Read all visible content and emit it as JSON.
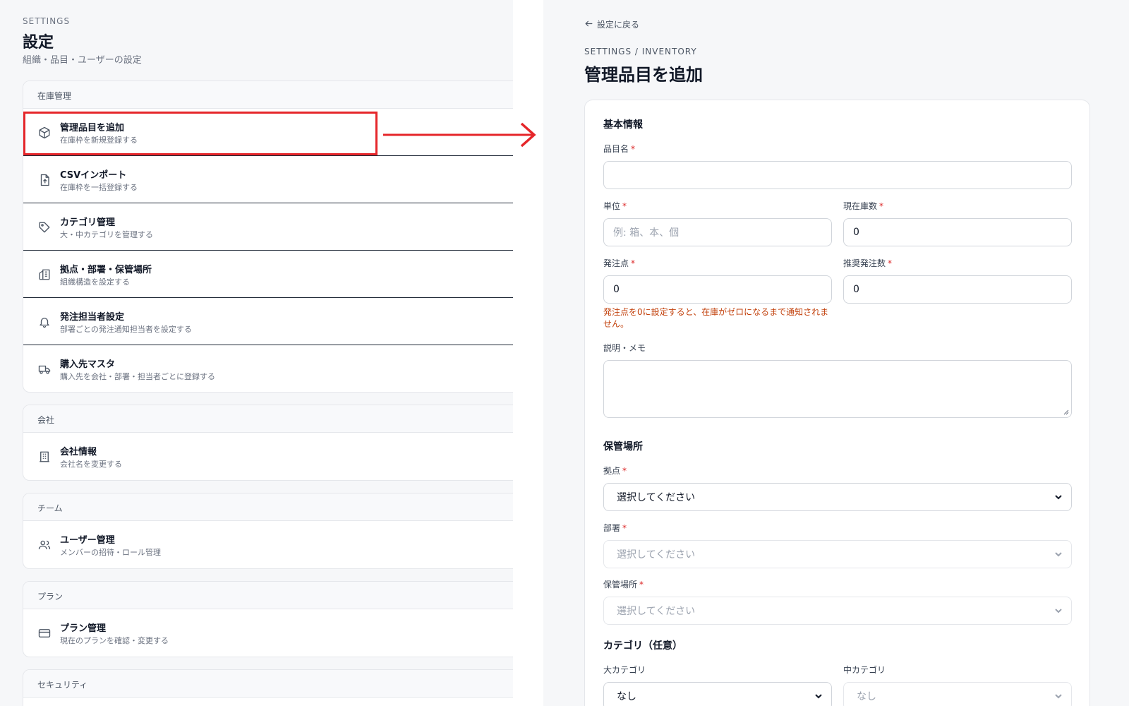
{
  "left": {
    "eyebrow": "SETTINGS",
    "title": "設定",
    "subtitle": "組織・品目・ユーザーの設定",
    "sections": [
      {
        "heading": "在庫管理",
        "items": [
          {
            "title": "管理品目を追加",
            "desc": "在庫枠を新規登録する",
            "icon": "box-icon"
          },
          {
            "title": "CSVインポート",
            "desc": "在庫枠を一括登録する",
            "icon": "file-upload-icon"
          },
          {
            "title": "カテゴリ管理",
            "desc": "大・中カテゴリを管理する",
            "icon": "tag-icon"
          },
          {
            "title": "拠点・部署・保管場所",
            "desc": "組織構造を設定する",
            "icon": "building-icon"
          },
          {
            "title": "発注担当者設定",
            "desc": "部署ごとの発注通知担当者を設定する",
            "icon": "bell-icon"
          },
          {
            "title": "購入先マスタ",
            "desc": "購入先を会社・部署・担当者ごとに登録する",
            "icon": "truck-icon"
          }
        ]
      },
      {
        "heading": "会社",
        "items": [
          {
            "title": "会社情報",
            "desc": "会社名を変更する",
            "icon": "office-icon"
          }
        ]
      },
      {
        "heading": "チーム",
        "items": [
          {
            "title": "ユーザー管理",
            "desc": "メンバーの招待・ロール管理",
            "icon": "users-icon"
          }
        ]
      },
      {
        "heading": "プラン",
        "items": [
          {
            "title": "プラン管理",
            "desc": "現在のプランを確認・変更する",
            "icon": "credit-card-icon"
          }
        ]
      },
      {
        "heading": "セキュリティ",
        "items": []
      }
    ]
  },
  "right": {
    "back_label": "設定に戻る",
    "eyebrow": "SETTINGS / INVENTORY",
    "title": "管理品目を追加",
    "basic": {
      "heading": "基本情報",
      "name_label": "品目名",
      "name_value": "",
      "unit_label": "単位",
      "unit_placeholder": "例: 箱、本、個",
      "stock_label": "現在庫数",
      "stock_value": "0",
      "reorder_label": "発注点",
      "reorder_value": "0",
      "recommended_label": "推奨発注数",
      "recommended_value": "0",
      "reorder_warning": "発注点を0に設定すると、在庫がゼロになるまで通知されません。",
      "memo_label": "説明・メモ"
    },
    "storage": {
      "heading": "保管場所",
      "base_label": "拠点",
      "base_value": "選択してください",
      "dept_label": "部署",
      "dept_value": "選択してください",
      "place_label": "保管場所",
      "place_value": "選択してください"
    },
    "category": {
      "heading": "カテゴリ（任意）",
      "major_label": "大カテゴリ",
      "major_value": "なし",
      "minor_label": "中カテゴリ",
      "minor_value": "なし"
    },
    "required_mark": "*"
  },
  "colors": {
    "highlight": "#e5262a",
    "required": "#dc2626",
    "warning": "#c2410c",
    "background": "#f6f7f9"
  }
}
